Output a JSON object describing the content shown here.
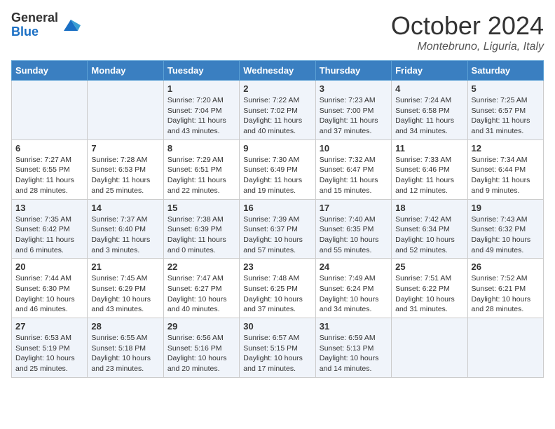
{
  "logo": {
    "general": "General",
    "blue": "Blue"
  },
  "title": "October 2024",
  "location": "Montebruno, Liguria, Italy",
  "days_of_week": [
    "Sunday",
    "Monday",
    "Tuesday",
    "Wednesday",
    "Thursday",
    "Friday",
    "Saturday"
  ],
  "weeks": [
    [
      {
        "day": "",
        "content": ""
      },
      {
        "day": "",
        "content": ""
      },
      {
        "day": "1",
        "content": "Sunrise: 7:20 AM\nSunset: 7:04 PM\nDaylight: 11 hours and 43 minutes."
      },
      {
        "day": "2",
        "content": "Sunrise: 7:22 AM\nSunset: 7:02 PM\nDaylight: 11 hours and 40 minutes."
      },
      {
        "day": "3",
        "content": "Sunrise: 7:23 AM\nSunset: 7:00 PM\nDaylight: 11 hours and 37 minutes."
      },
      {
        "day": "4",
        "content": "Sunrise: 7:24 AM\nSunset: 6:58 PM\nDaylight: 11 hours and 34 minutes."
      },
      {
        "day": "5",
        "content": "Sunrise: 7:25 AM\nSunset: 6:57 PM\nDaylight: 11 hours and 31 minutes."
      }
    ],
    [
      {
        "day": "6",
        "content": "Sunrise: 7:27 AM\nSunset: 6:55 PM\nDaylight: 11 hours and 28 minutes."
      },
      {
        "day": "7",
        "content": "Sunrise: 7:28 AM\nSunset: 6:53 PM\nDaylight: 11 hours and 25 minutes."
      },
      {
        "day": "8",
        "content": "Sunrise: 7:29 AM\nSunset: 6:51 PM\nDaylight: 11 hours and 22 minutes."
      },
      {
        "day": "9",
        "content": "Sunrise: 7:30 AM\nSunset: 6:49 PM\nDaylight: 11 hours and 19 minutes."
      },
      {
        "day": "10",
        "content": "Sunrise: 7:32 AM\nSunset: 6:47 PM\nDaylight: 11 hours and 15 minutes."
      },
      {
        "day": "11",
        "content": "Sunrise: 7:33 AM\nSunset: 6:46 PM\nDaylight: 11 hours and 12 minutes."
      },
      {
        "day": "12",
        "content": "Sunrise: 7:34 AM\nSunset: 6:44 PM\nDaylight: 11 hours and 9 minutes."
      }
    ],
    [
      {
        "day": "13",
        "content": "Sunrise: 7:35 AM\nSunset: 6:42 PM\nDaylight: 11 hours and 6 minutes."
      },
      {
        "day": "14",
        "content": "Sunrise: 7:37 AM\nSunset: 6:40 PM\nDaylight: 11 hours and 3 minutes."
      },
      {
        "day": "15",
        "content": "Sunrise: 7:38 AM\nSunset: 6:39 PM\nDaylight: 11 hours and 0 minutes."
      },
      {
        "day": "16",
        "content": "Sunrise: 7:39 AM\nSunset: 6:37 PM\nDaylight: 10 hours and 57 minutes."
      },
      {
        "day": "17",
        "content": "Sunrise: 7:40 AM\nSunset: 6:35 PM\nDaylight: 10 hours and 55 minutes."
      },
      {
        "day": "18",
        "content": "Sunrise: 7:42 AM\nSunset: 6:34 PM\nDaylight: 10 hours and 52 minutes."
      },
      {
        "day": "19",
        "content": "Sunrise: 7:43 AM\nSunset: 6:32 PM\nDaylight: 10 hours and 49 minutes."
      }
    ],
    [
      {
        "day": "20",
        "content": "Sunrise: 7:44 AM\nSunset: 6:30 PM\nDaylight: 10 hours and 46 minutes."
      },
      {
        "day": "21",
        "content": "Sunrise: 7:45 AM\nSunset: 6:29 PM\nDaylight: 10 hours and 43 minutes."
      },
      {
        "day": "22",
        "content": "Sunrise: 7:47 AM\nSunset: 6:27 PM\nDaylight: 10 hours and 40 minutes."
      },
      {
        "day": "23",
        "content": "Sunrise: 7:48 AM\nSunset: 6:25 PM\nDaylight: 10 hours and 37 minutes."
      },
      {
        "day": "24",
        "content": "Sunrise: 7:49 AM\nSunset: 6:24 PM\nDaylight: 10 hours and 34 minutes."
      },
      {
        "day": "25",
        "content": "Sunrise: 7:51 AM\nSunset: 6:22 PM\nDaylight: 10 hours and 31 minutes."
      },
      {
        "day": "26",
        "content": "Sunrise: 7:52 AM\nSunset: 6:21 PM\nDaylight: 10 hours and 28 minutes."
      }
    ],
    [
      {
        "day": "27",
        "content": "Sunrise: 6:53 AM\nSunset: 5:19 PM\nDaylight: 10 hours and 25 minutes."
      },
      {
        "day": "28",
        "content": "Sunrise: 6:55 AM\nSunset: 5:18 PM\nDaylight: 10 hours and 23 minutes."
      },
      {
        "day": "29",
        "content": "Sunrise: 6:56 AM\nSunset: 5:16 PM\nDaylight: 10 hours and 20 minutes."
      },
      {
        "day": "30",
        "content": "Sunrise: 6:57 AM\nSunset: 5:15 PM\nDaylight: 10 hours and 17 minutes."
      },
      {
        "day": "31",
        "content": "Sunrise: 6:59 AM\nSunset: 5:13 PM\nDaylight: 10 hours and 14 minutes."
      },
      {
        "day": "",
        "content": ""
      },
      {
        "day": "",
        "content": ""
      }
    ]
  ]
}
